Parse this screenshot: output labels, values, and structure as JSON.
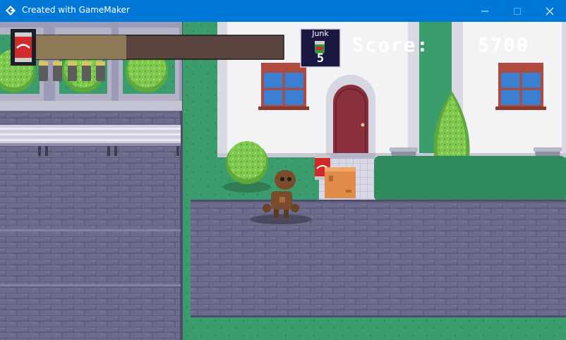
{
  "window": {
    "title": "Created with GameMaker",
    "accent_color": "#0078d7",
    "icons": [
      "gamemaker-icon",
      "minimize-icon",
      "maximize-icon",
      "close-icon"
    ]
  },
  "hud": {
    "junk_label": "Junk",
    "junk_count": "5",
    "score_label": "Score:",
    "score_value": "5700",
    "energy_fraction": 0.37,
    "energy_fill_color": "#8d7955",
    "energy_empty_color": "#5a4440",
    "battery_count": 5
  },
  "scene": {
    "icons": [
      "soda-can-icon",
      "battery-icon",
      "junk-jar-icon",
      "robot-player",
      "cardboard-box",
      "trash-bin",
      "house-door",
      "window",
      "bush",
      "park-bench"
    ],
    "colors": {
      "grass": "#3b9c6c",
      "cobblestone": "#6e6c8c",
      "house_wall": "#f3f2f5",
      "door": "#8a2f3c"
    }
  }
}
